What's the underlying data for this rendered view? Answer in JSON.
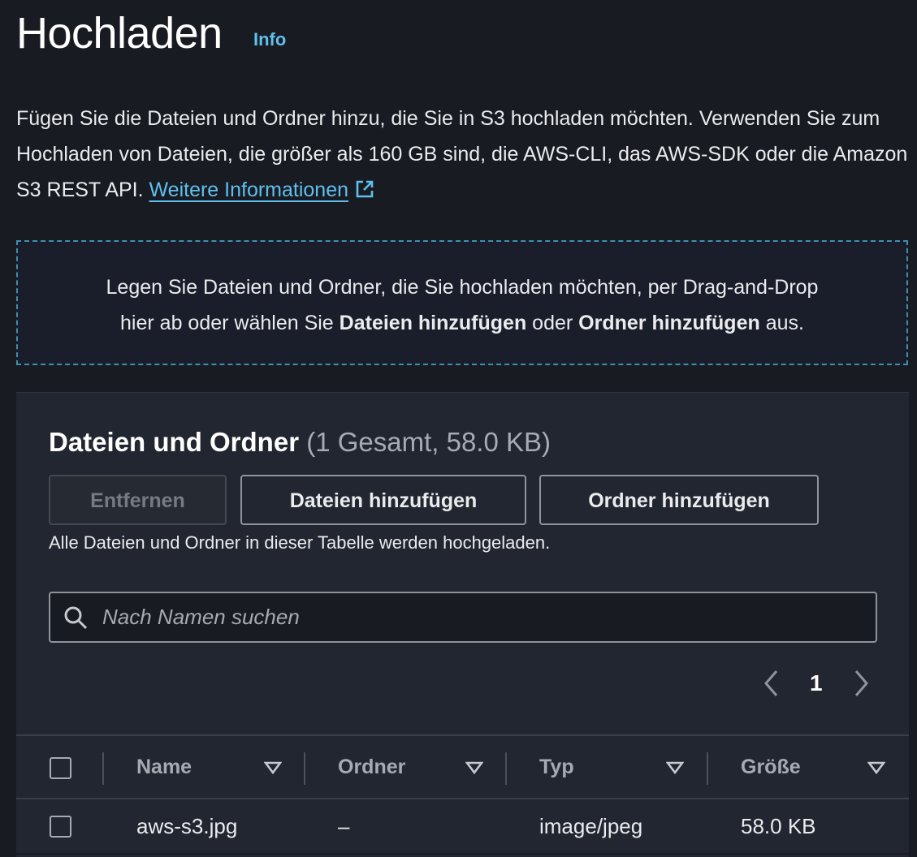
{
  "header": {
    "title": "Hochladen",
    "info_link": "Info"
  },
  "description": {
    "text": "Fügen Sie die Dateien und Ordner hinzu, die Sie in S3 hochladen möchten. Verwenden Sie zum Hochladen von Dateien, die größer als 160 GB sind, die AWS-CLI, das AWS-SDK oder die Amazon S3 REST API.",
    "link": "Weitere Informationen"
  },
  "dropzone": {
    "line1": "Legen Sie Dateien und Ordner, die Sie hochladen möchten, per Drag-and-Drop",
    "pre": "hier ab oder wählen Sie ",
    "bold1": "Dateien hinzufügen",
    "mid": " oder ",
    "bold2": "Ordner hinzufügen",
    "post": " aus."
  },
  "panel": {
    "title": "Dateien und Ordner",
    "count": "(1 Gesamt, 58.0 KB)",
    "buttons": {
      "remove": "Entfernen",
      "add_files": "Dateien hinzufügen",
      "add_folder": "Ordner hinzufügen"
    },
    "hint": "Alle Dateien und Ordner in dieser Tabelle werden hochgeladen.",
    "search": {
      "placeholder": "Nach Namen suchen",
      "value": ""
    },
    "pagination": {
      "current_page": "1"
    },
    "columns": {
      "name": "Name",
      "folder": "Ordner",
      "type": "Typ",
      "size": "Größe"
    },
    "rows": [
      {
        "name": "aws-s3.jpg",
        "folder": "–",
        "type": "image/jpeg",
        "size": "58.0 KB"
      }
    ]
  },
  "colors": {
    "background": "#191b23",
    "panel": "#222630",
    "link": "#5fc0ec",
    "dropzone_border": "#3e8fb0"
  }
}
